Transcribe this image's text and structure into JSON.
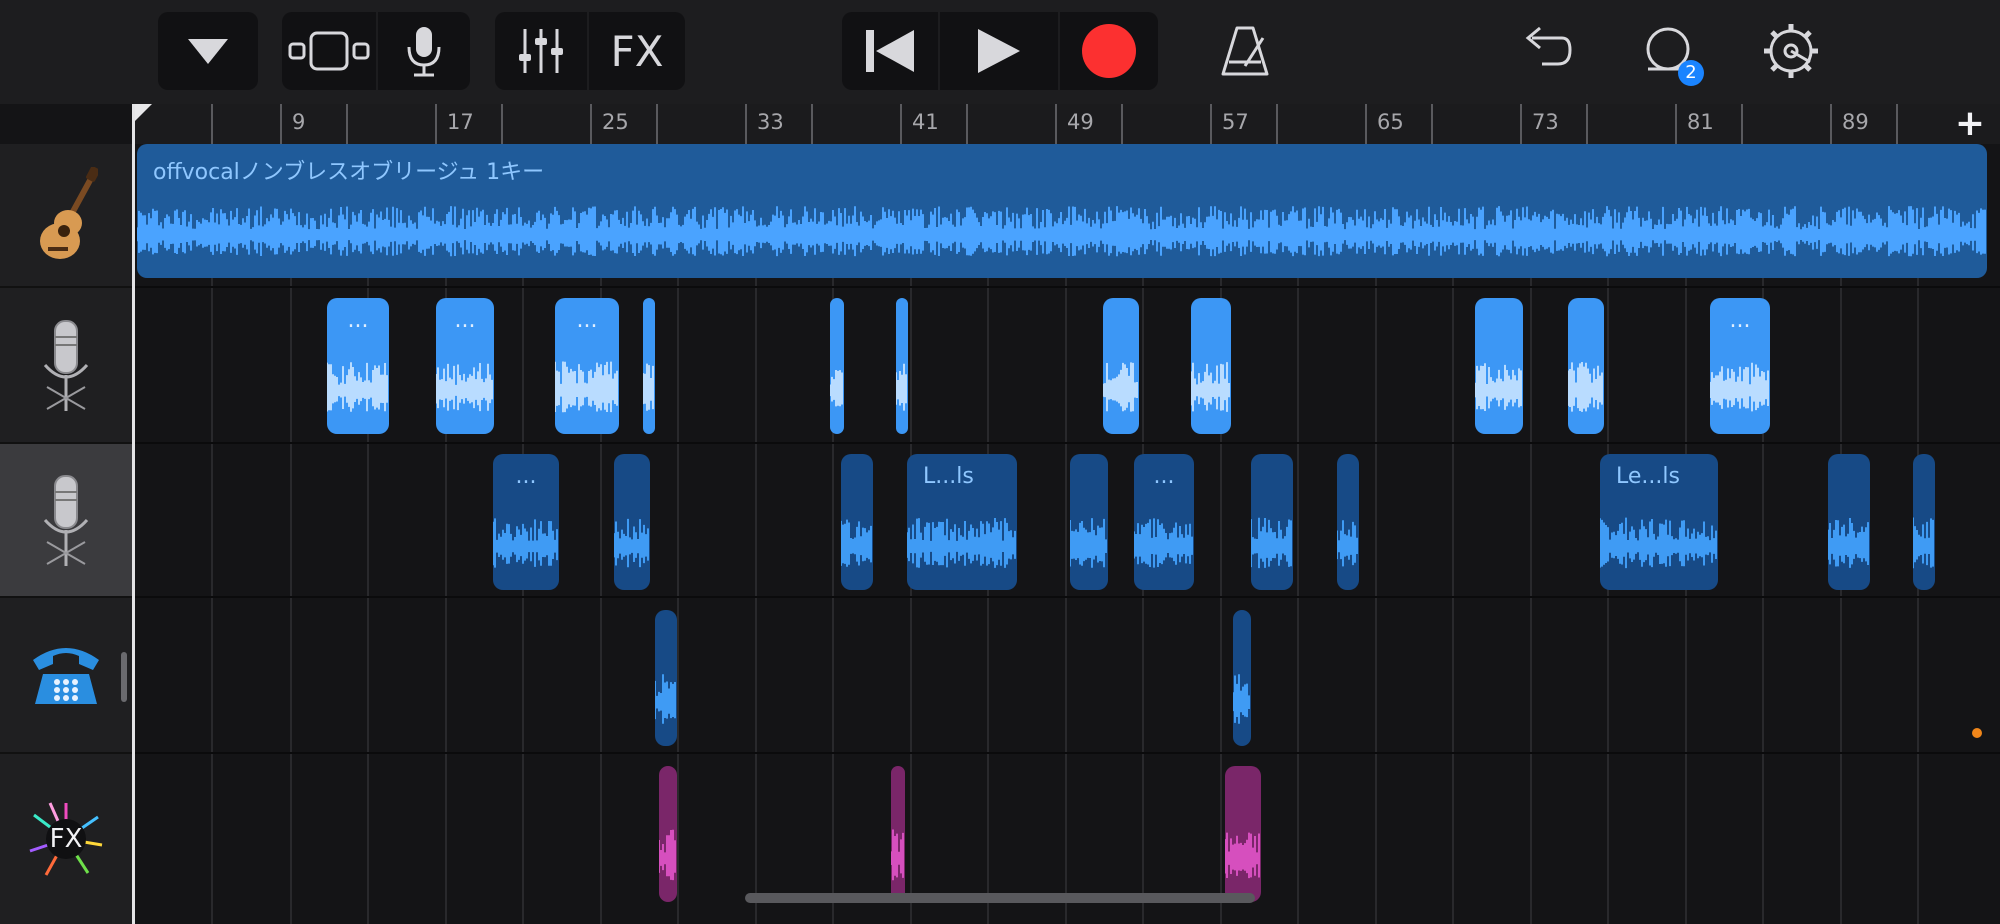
{
  "toolbar": {
    "browser_label": "browser",
    "tracks_view_label": "tracks view",
    "mic_label": "mic",
    "mixer_label": "mixer",
    "fx_label": "FX",
    "rewind_label": "rewind",
    "play_label": "play",
    "record_label": "record",
    "metronome_label": "metronome",
    "undo_label": "undo",
    "loops_label": "loops",
    "loops_badge": "2",
    "settings_label": "settings",
    "colors": {
      "record": "#fc3030",
      "badge": "#1a84ff"
    }
  },
  "ruler": {
    "bar_labels": [
      "9",
      "17",
      "25",
      "33",
      "41",
      "49",
      "57",
      "65",
      "73",
      "81",
      "89"
    ],
    "add_track_label": "+"
  },
  "tracks": [
    {
      "name": "acoustic-guitar",
      "icon": "guitar-icon"
    },
    {
      "name": "audio-recorder-1",
      "icon": "microphone-icon"
    },
    {
      "name": "audio-recorder-2",
      "icon": "microphone-icon",
      "selected": true
    },
    {
      "name": "telephone",
      "icon": "telephone-icon"
    },
    {
      "name": "fx",
      "icon": "fx-burst-icon",
      "icon_text": "FX"
    }
  ],
  "regions": {
    "track1": [
      {
        "label": "offvocalノンブレスオブリージュ 1キー"
      }
    ],
    "track2": [
      {
        "label": "..."
      },
      {
        "label": "..."
      },
      {
        "label": "..."
      },
      {
        "label": ""
      },
      {
        "label": ""
      },
      {
        "label": ""
      },
      {
        "label": ""
      },
      {
        "label": ""
      },
      {
        "label": ""
      },
      {
        "label": ""
      },
      {
        "label": "..."
      }
    ],
    "track3": [
      {
        "label": "..."
      },
      {
        "label": ""
      },
      {
        "label": ""
      },
      {
        "label": "L...ls"
      },
      {
        "label": ""
      },
      {
        "label": "..."
      },
      {
        "label": ""
      },
      {
        "label": ""
      },
      {
        "label": "Le...ls"
      },
      {
        "label": ""
      },
      {
        "label": ""
      }
    ],
    "track4": [
      {
        "label": ""
      },
      {
        "label": ""
      }
    ],
    "track5": [
      {
        "label": ""
      },
      {
        "label": ""
      },
      {
        "label": ""
      }
    ]
  }
}
